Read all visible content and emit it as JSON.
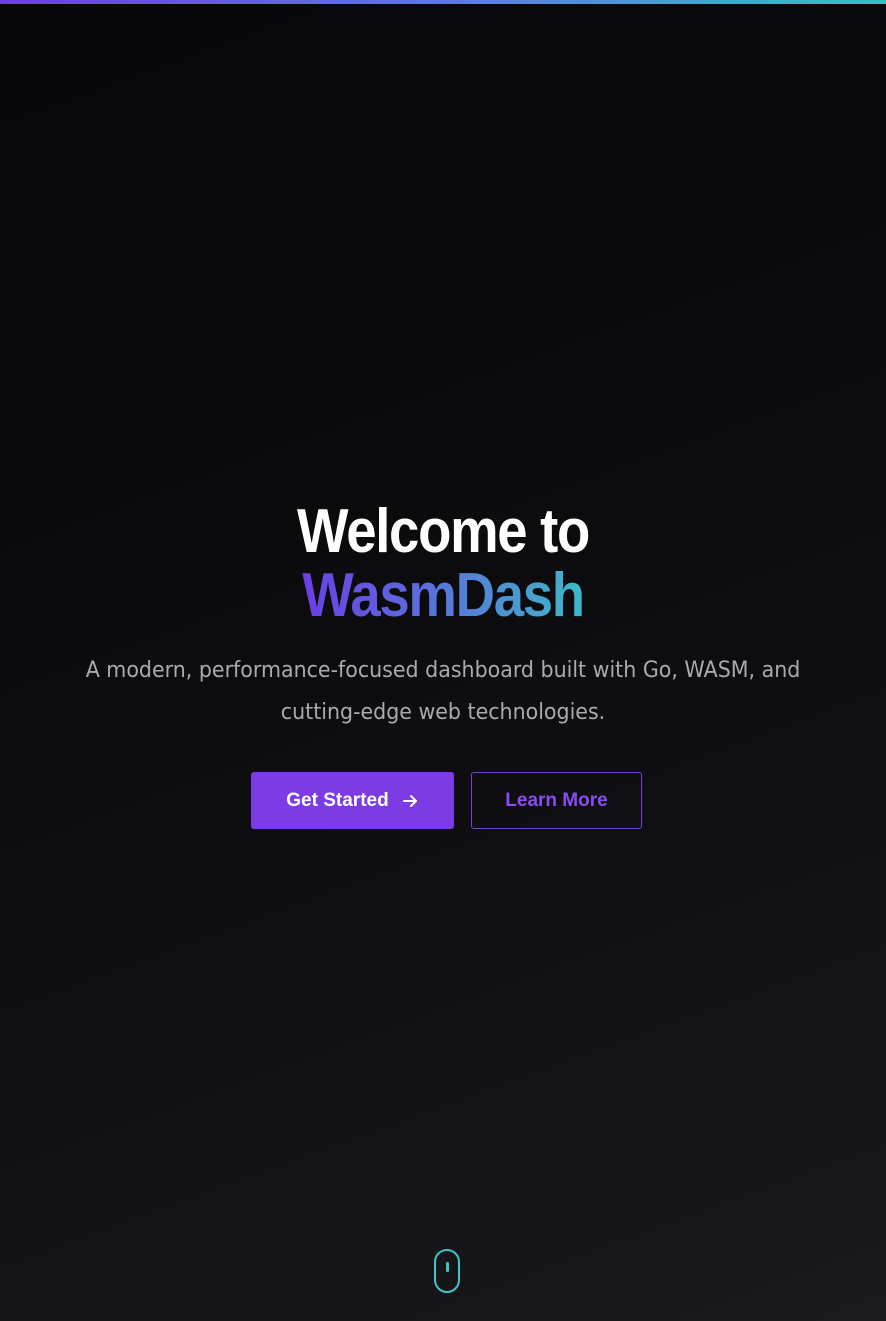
{
  "hero": {
    "headline_line1": "Welcome to",
    "headline_brand": "WasmDash",
    "subtitle": "A modern, performance-focused dashboard built with Go, WASM, and cutting-edge web technologies."
  },
  "actions": {
    "primary_label": "Get Started",
    "primary_icon": "arrow-right-icon",
    "secondary_label": "Learn More"
  },
  "scroll_indicator": {
    "icon": "mouse-scroll-icon"
  },
  "colors": {
    "accent": "#7d3be6",
    "gradient_start": "#6b3fe4",
    "gradient_end": "#3eb8c8",
    "background": "#0b0b0d",
    "subtitle_text": "#a9a9b0"
  }
}
